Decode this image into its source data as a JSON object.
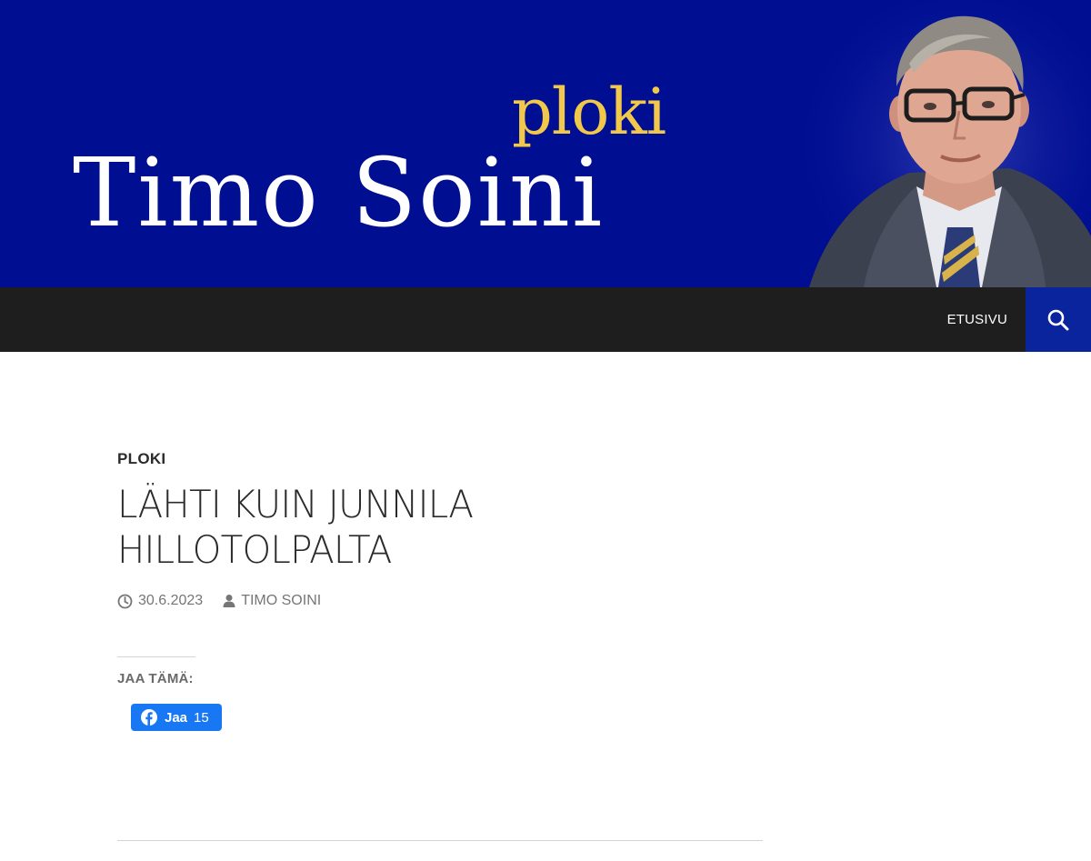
{
  "header": {
    "ploki_word": "ploki",
    "site_name": "Timo Soini",
    "banner_color": "#000e92",
    "accent_color": "#f2c84b"
  },
  "nav": {
    "items": [
      {
        "label": "ETUSIVU"
      }
    ],
    "search_icon": "search-icon",
    "search_bg": "#0a249e"
  },
  "post": {
    "category": "PLOKI",
    "title_line1": "LÄHTI KUIN JUNNILA",
    "title_line2": "HILLOTOLPALTA",
    "date": "30.6.2023",
    "author": "TIMO SOINI"
  },
  "share": {
    "heading": "JAA TÄMÄ:",
    "facebook_label": "Jaa",
    "facebook_count": "15",
    "facebook_color": "#1877f2"
  }
}
